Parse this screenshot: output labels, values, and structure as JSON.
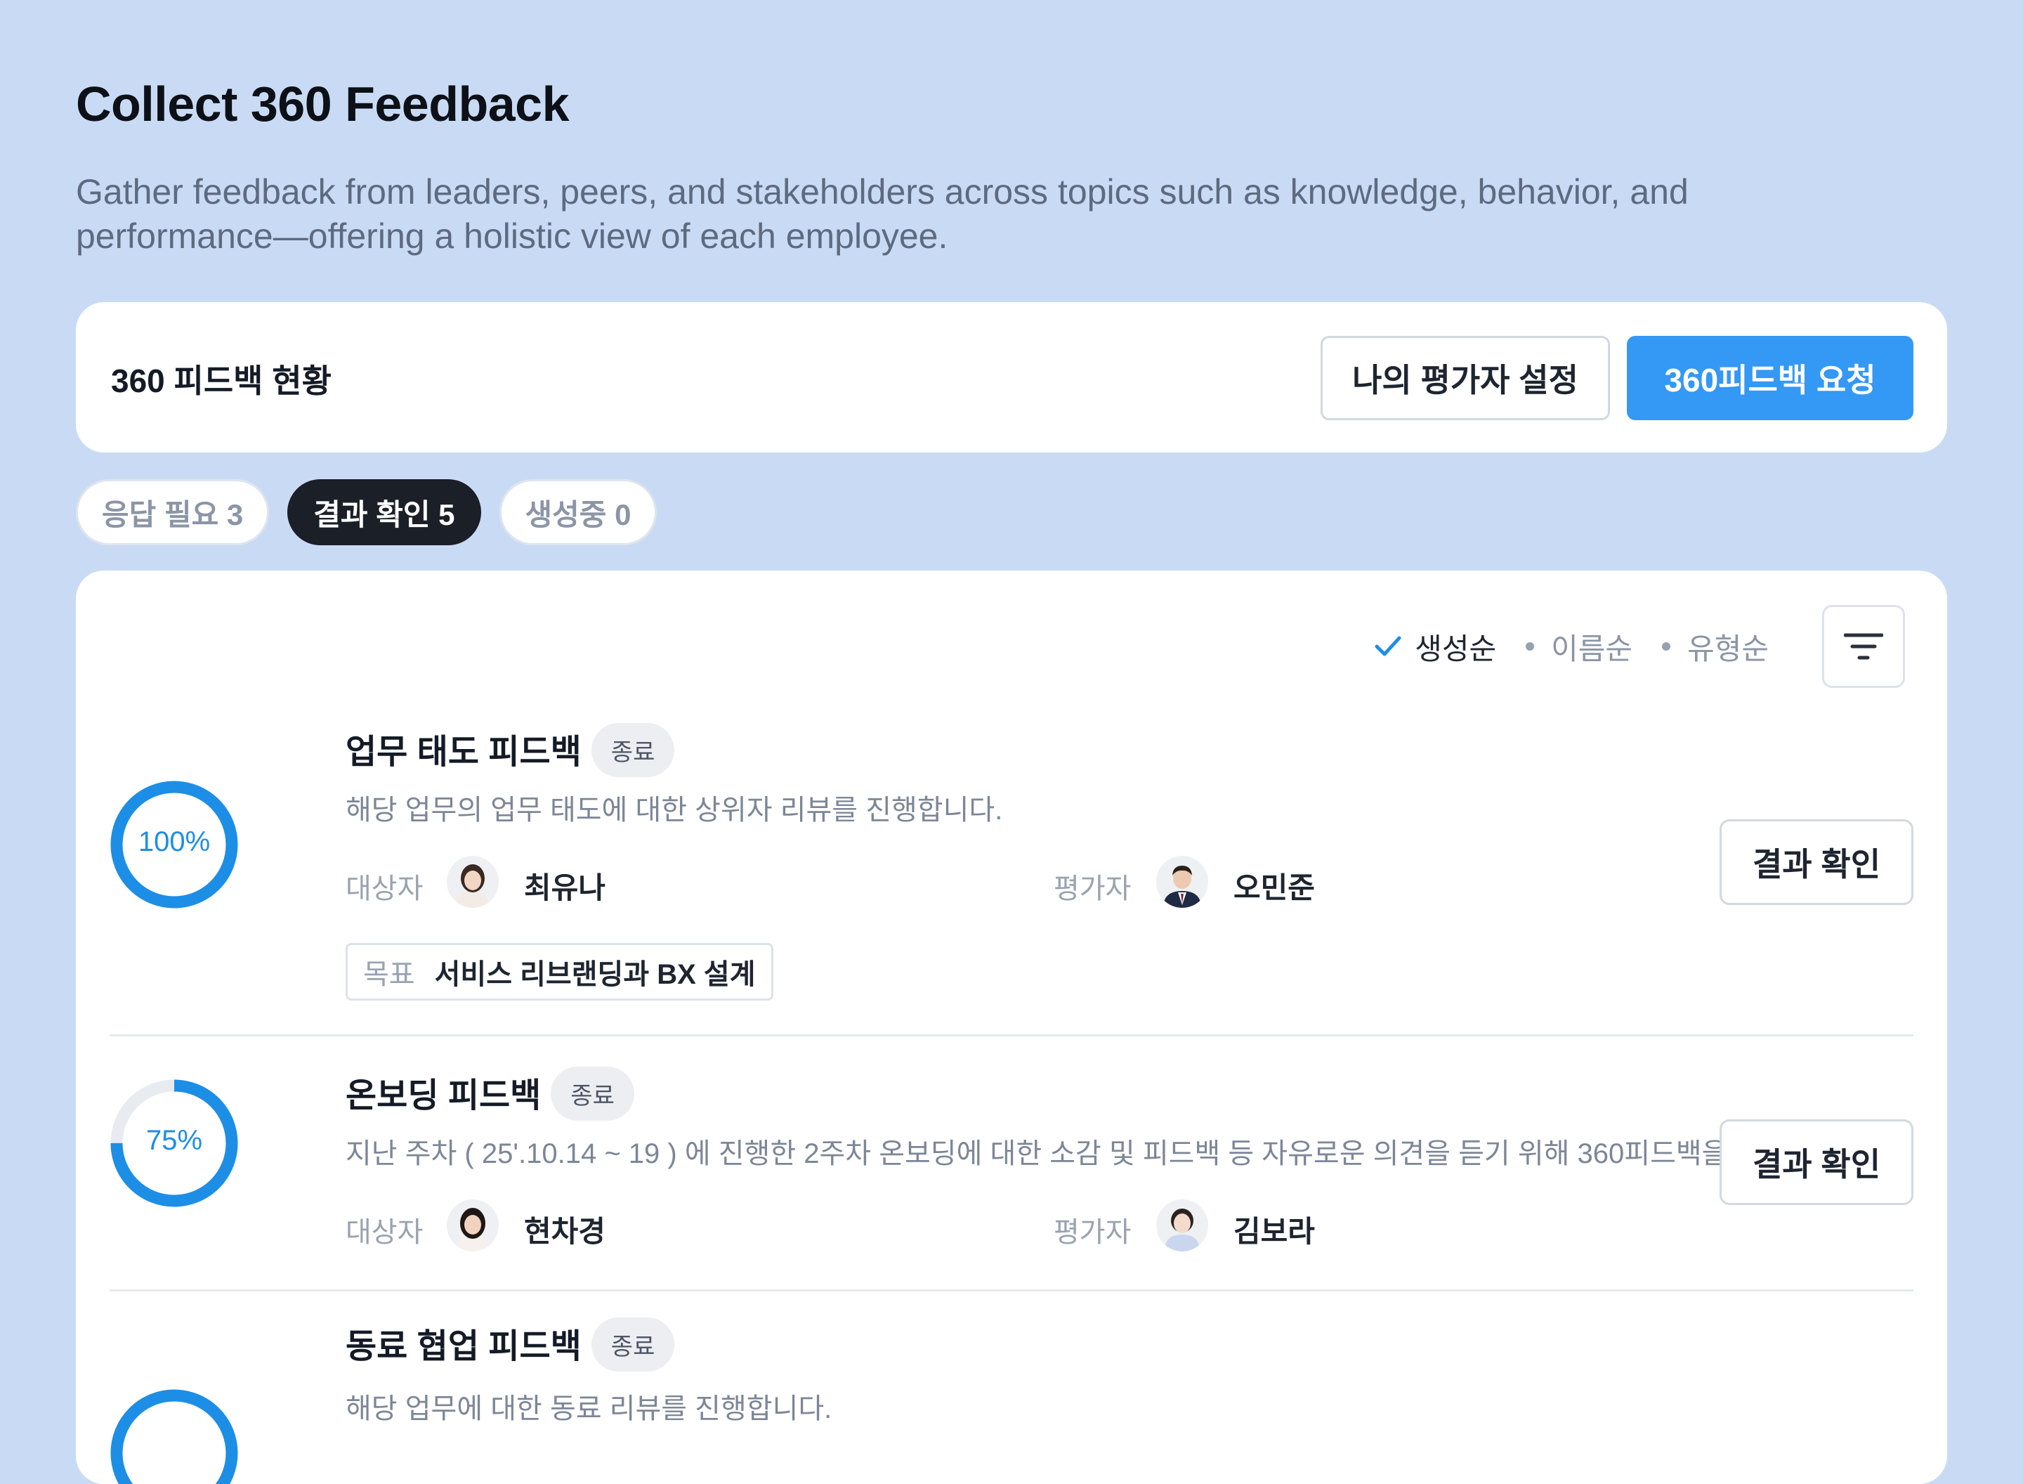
{
  "header": {
    "title": "Collect 360 Feedback",
    "description": "Gather feedback from leaders, peers, and stakeholders across topics such as knowledge, behavior, and performance—offering a holistic view of each employee."
  },
  "status": {
    "title": "360 피드백 현황",
    "set_evaluators_label": "나의 평가자 설정",
    "request_label": "360피드백 요청"
  },
  "tabs": [
    {
      "label": "응답 필요 3",
      "active": false
    },
    {
      "label": "결과 확인 5",
      "active": true
    },
    {
      "label": "생성중 0",
      "active": false
    }
  ],
  "sort": {
    "options": [
      {
        "label": "생성순",
        "active": true
      },
      {
        "label": "이름순",
        "active": false
      },
      {
        "label": "유형순",
        "active": false
      }
    ],
    "filter_icon": "filter-icon"
  },
  "labels": {
    "target": "대상자",
    "evaluator": "평가자",
    "goal": "목표",
    "result_button": "결과 확인"
  },
  "items": [
    {
      "title": "업무 태도 피드백",
      "status": "종료",
      "progress": 100,
      "progress_label": "100%",
      "description": "해당 업무의 업무 태도에 대한 상위자 리뷰를 진행합니다.",
      "target_name": "최유나",
      "evaluator_name": "오민준",
      "goal_value": "서비스 리브랜딩과 BX 설계"
    },
    {
      "title": "온보딩 피드백",
      "status": "종료",
      "progress": 75,
      "progress_label": "75%",
      "description": "지난 주차 ( 25'.10.14 ~ 19 ) 에 진행한 2주차 온보딩에 대한 소감 및 피드백 등 자유로운 의견을 듣기 위해 360피드백을...",
      "target_name": "현차경",
      "evaluator_name": "김보라"
    },
    {
      "title": "동료 협업 피드백",
      "status": "종료",
      "progress": 100,
      "description": "해당 업무에 대한 동료 리뷰를 진행합니다."
    }
  ],
  "colors": {
    "background": "#c9dbf4",
    "primary": "#3498f5",
    "progress": "#1d8ee6",
    "progress_track": "#e8ebf0",
    "active_tab": "#1b1f28"
  }
}
